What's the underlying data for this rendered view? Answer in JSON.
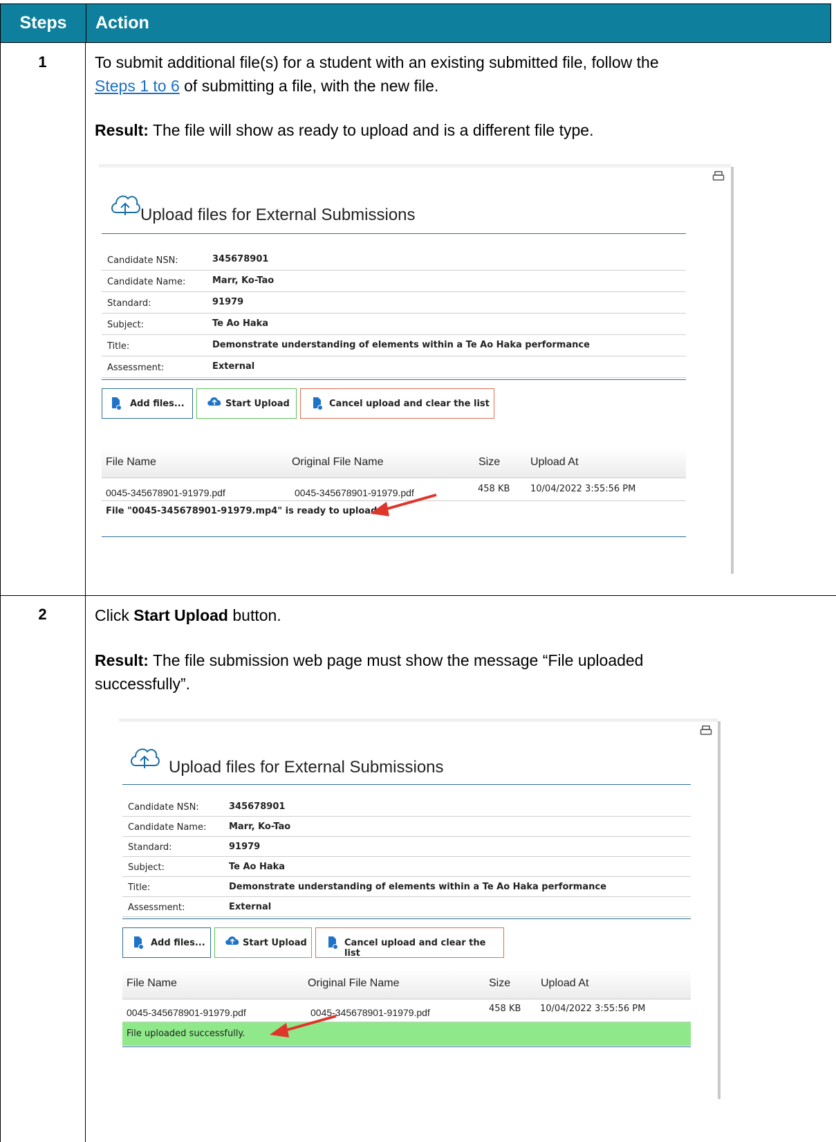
{
  "table": {
    "col_steps": "Steps",
    "col_action": "Action"
  },
  "step1": {
    "number": "1",
    "text_pre": "To submit additional file(s) for a student with an existing submitted file, follow the",
    "link": "Steps 1 to 6",
    "text_post": "of submitting a file, with the new file.",
    "result_label": "Result:",
    "result_text": "The file will show as ready to upload and is a different file type."
  },
  "step2": {
    "number": "2",
    "click": "Click",
    "button_name": "Start Upload",
    "button_word": "button.",
    "result_label": "Result:",
    "result_text_1": "The file submission web page must show the message “File uploaded",
    "result_text_2": "successfully”."
  },
  "panel": {
    "title": "Upload files for External Submissions",
    "fields": [
      {
        "label": "Candidate NSN:",
        "value": "345678901"
      },
      {
        "label": "Candidate Name:",
        "value": "Marr, Ko-Tao"
      },
      {
        "label": "Standard:",
        "value": "91979"
      },
      {
        "label": "Subject:",
        "value": "Te Ao Haka"
      },
      {
        "label": "Title:",
        "value": "Demonstrate understanding of elements within a Te Ao Haka performance"
      },
      {
        "label": "Assessment:",
        "value": "External"
      }
    ],
    "buttons": {
      "add": "Add files...",
      "start": "Start Upload",
      "cancel": "Cancel upload and clear the list"
    },
    "columns": {
      "file_name": "File Name",
      "original": "Original File Name",
      "size": "Size",
      "upload_at": "Upload At"
    },
    "file": {
      "name": "0045-345678901-91979.pdf",
      "original": "0045-345678901-91979.pdf",
      "size": "458 KB",
      "upload_at": "10/04/2022 3:55:56 PM"
    },
    "ready_msg": "File \"0045-345678901-91979.mp4\" is ready to upload.",
    "success_msg": "File uploaded successfully."
  },
  "icons": {
    "print": "print-icon",
    "cloud": "cloud-upload-icon",
    "file_add": "file-add-icon",
    "upload": "upload-icon",
    "arrow": "red-arrow-annotation"
  },
  "colors": {
    "header_bg": "#0e7f9c",
    "link": "#1a6fc4",
    "success_bg": "#8fe88a",
    "arrow": "#e0352b"
  }
}
